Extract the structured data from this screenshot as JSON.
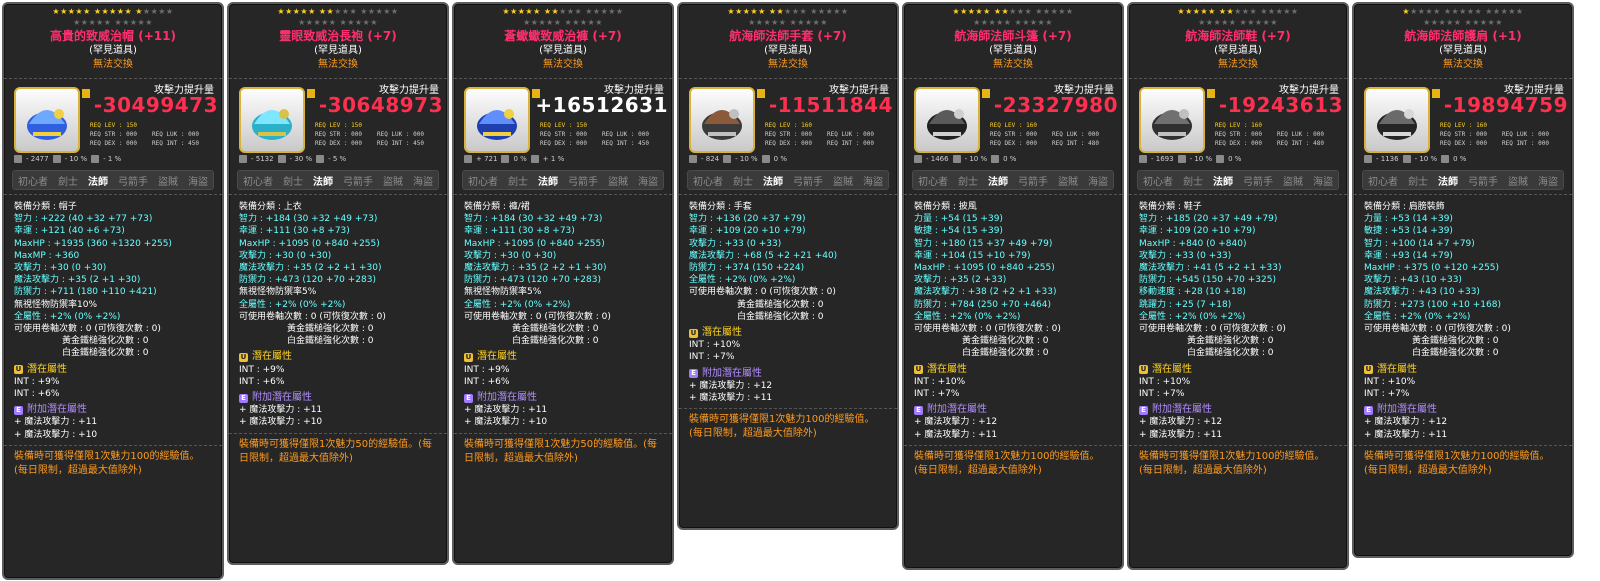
{
  "colors": {
    "name": "#ff2f6e",
    "star": "#ffd21f",
    "atk_negative": "#ff2f4f",
    "panel": "#262626",
    "green": "#58ff58",
    "purple": "#b18cff",
    "orange": "#ff9b1e"
  },
  "labels": {
    "rank": "(罕見道具)",
    "tradeable": "無法交換",
    "atk_gain": "攻擊力提升量",
    "jobs": [
      "初心者",
      "劍士",
      "法師",
      "弓箭手",
      "盜賊",
      "海盜"
    ],
    "potential": "潛在屬性",
    "additional_potential": "附加潛在屬性"
  },
  "items": [
    {
      "name": "高貴的致威治帽 (+11)",
      "stars_filled": 11,
      "atk_change": "-30499473",
      "req_lev": "REQ LEV : 150",
      "req": [
        "REQ STR : 000",
        "REQ LUK : 000",
        "REQ DEX : 000",
        "REQ INT : 450"
      ],
      "mini": [
        "- 2477",
        "- 10 %",
        "- 1 %"
      ],
      "stats": [
        "裝備分類 : 帽子",
        "智力 : +222 (40 +32 +77 +73)",
        "幸運 : +121 (40 +6 +73)",
        "MaxHP : +1935 (360 +1320 +255)",
        "MaxMP : +360",
        "攻擊力 : +30 (0 +30)",
        "魔法攻擊力 : +35 (2 +1 +30)",
        "防禦力 : +711 (180 +110 +421)",
        "無視怪物防禦率10%",
        "全屬性 : +2% (0% +2%)",
        "可使用卷軸次數 : 0 (可恢復次數 : 0)",
        "黃金鐵槌強化次數 : 0",
        "白金鐵槌強化次數 : 0"
      ],
      "potential": [
        "INT : +9%",
        "INT : +6%"
      ],
      "additional": [
        "+ 魔法攻擊力 : +11",
        "+ 魔法攻擊力 : +10"
      ],
      "footer": "裝備時可獲得僅限1次魅力100的經驗值。(每日限制，超過最大值除外)"
    },
    {
      "name": "靈眼致威治長袍 (+7)",
      "stars_filled": 7,
      "atk_change": "-30648973",
      "req_lev": "REQ LEV : 150",
      "req": [
        "REQ STR : 000",
        "REQ LUK : 000",
        "REQ DEX : 000",
        "REQ INT : 450"
      ],
      "mini": [
        "- 5132",
        "- 30 %",
        "- 5 %"
      ],
      "stats": [
        "裝備分類 : 上衣",
        "智力 : +184 (30 +32 +49 +73)",
        "幸運 : +111 (30 +8 +73)",
        "MaxHP : +1095 (0 +840 +255)",
        "攻擊力 : +30 (0 +30)",
        "魔法攻擊力 : +35 (2 +2 +1 +30)",
        "防禦力 : +473 (120 +70 +283)",
        "無視怪物防禦率5%",
        "全屬性 : +2% (0% +2%)",
        "可使用卷軸次數 : 0 (可恢復次數 : 0)",
        "黃金鐵槌強化次數 : 0",
        "白金鐵槌強化次數 : 0"
      ],
      "potential": [
        "INT : +9%",
        "INT : +6%"
      ],
      "additional": [
        "+ 魔法攻擊力 : +11",
        "+ 魔法攻擊力 : +10"
      ],
      "footer": "裝備時可獲得僅限1次魅力50的經驗值。(每日限制，超過最大值除外)"
    },
    {
      "name": "蒼蠍蠍致威治褲 (+7)",
      "stars_filled": 7,
      "atk_change": "+16512631",
      "req_lev": "REQ LEV : 150",
      "req": [
        "REQ STR : 000",
        "REQ LUK : 000",
        "REQ DEX : 000",
        "REQ INT : 450"
      ],
      "mini": [
        "+ 721",
        "0 %",
        "+ 1 %"
      ],
      "stats": [
        "裝備分類 : 褲/裙",
        "智力 : +184 (30 +32 +49 +73)",
        "幸運 : +111 (30 +8 +73)",
        "MaxHP : +1095 (0 +840 +255)",
        "攻擊力 : +30 (0 +30)",
        "魔法攻擊力 : +35 (2 +2 +1 +30)",
        "防禦力 : +473 (120 +70 +283)",
        "無視怪物防禦率5%",
        "全屬性 : +2% (0% +2%)",
        "可使用卷軸次數 : 0 (可恢復次數 : 0)",
        "黃金鐵槌強化次數 : 0",
        "白金鐵槌強化次數 : 0"
      ],
      "potential": [
        "INT : +9%",
        "INT : +6%"
      ],
      "additional": [
        "+ 魔法攻擊力 : +11",
        "+ 魔法攻擊力 : +10"
      ],
      "footer": "裝備時可獲得僅限1次魅力50的經驗值。(每日限制，超過最大值除外)"
    },
    {
      "name": "航海師法師手套 (+7)",
      "stars_filled": 7,
      "atk_change": "-11511844",
      "req_lev": "REQ LEV : 160",
      "req": [
        "REQ STR : 000",
        "REQ LUK : 000",
        "REQ DEX : 000",
        "REQ INT : 000"
      ],
      "mini": [
        "- 824",
        "- 10 %",
        "0 %"
      ],
      "stats": [
        "裝備分類 : 手套",
        "智力 : +136 (20 +37 +79)",
        "幸運 : +109 (20 +10 +79)",
        "攻擊力 : +33 (0 +33)",
        "魔法攻擊力 : +68 (5 +2 +21 +40)",
        "防禦力 : +374 (150 +224)",
        "全屬性 : +2% (0% +2%)",
        "可使用卷軸次數 : 0 (可恢復次數 : 0)",
        "黃金鐵槌強化次數 : 0",
        "白金鐵槌強化次數 : 0"
      ],
      "potential": [
        "INT : +10%",
        "INT : +7%"
      ],
      "additional": [
        "+ 魔法攻擊力 : +12",
        "+ 魔法攻擊力 : +11"
      ],
      "footer": "裝備時可獲得僅限1次魅力100的經驗值。(每日限制，超過最大值除外)"
    },
    {
      "name": "航海師法師斗篷 (+7)",
      "stars_filled": 7,
      "atk_change": "-23327980",
      "req_lev": "REQ LEV : 160",
      "req": [
        "REQ STR : 000",
        "REQ LUK : 000",
        "REQ DEX : 000",
        "REQ INT : 480"
      ],
      "mini": [
        "- 1466",
        "- 10 %",
        "0 %"
      ],
      "stats": [
        "裝備分類 : 披風",
        "力量 : +54 (15 +39)",
        "敏捷 : +54 (15 +39)",
        "智力 : +180 (15 +37 +49 +79)",
        "幸運 : +104 (15 +10 +79)",
        "MaxHP : +1095 (0 +840 +255)",
        "攻擊力 : +35 (2 +33)",
        "魔法攻擊力 : +38 (2 +2 +1 +33)",
        "防禦力 : +784 (250 +70 +464)",
        "全屬性 : +2% (0% +2%)",
        "可使用卷軸次數 : 0 (可恢復次數 : 0)",
        "黃金鐵槌強化次數 : 0",
        "白金鐵槌強化次數 : 0"
      ],
      "potential": [
        "INT : +10%",
        "INT : +7%"
      ],
      "additional": [
        "+ 魔法攻擊力 : +12",
        "+ 魔法攻擊力 : +11"
      ],
      "footer": "裝備時可獲得僅限1次魅力100的經驗值。(每日限制，超過最大值除外)"
    },
    {
      "name": "航海師法師鞋 (+7)",
      "stars_filled": 7,
      "atk_change": "-19243613",
      "req_lev": "REQ LEV : 160",
      "req": [
        "REQ STR : 000",
        "REQ LUK : 000",
        "REQ DEX : 000",
        "REQ INT : 480"
      ],
      "mini": [
        "- 1693",
        "- 10 %",
        "0 %"
      ],
      "stats": [
        "裝備分類 : 鞋子",
        "智力 : +185 (20 +37 +49 +79)",
        "幸運 : +109 (20 +10 +79)",
        "MaxHP : +840 (0 +840)",
        "攻擊力 : +33 (0 +33)",
        "魔法攻擊力 : +41 (5 +2 +1 +33)",
        "防禦力 : +545 (150 +70 +325)",
        "移動速度 : +28 (10 +18)",
        "跳躍力 : +25 (7 +18)",
        "全屬性 : +2% (0% +2%)",
        "可使用卷軸次數 : 0 (可恢復次數 : 0)",
        "黃金鐵槌強化次數 : 0",
        "白金鐵槌強化次數 : 0"
      ],
      "potential": [
        "INT : +10%",
        "INT : +7%"
      ],
      "additional": [
        "+ 魔法攻擊力 : +12",
        "+ 魔法攻擊力 : +11"
      ],
      "footer": "裝備時可獲得僅限1次魅力100的經驗值。(每日限制，超過最大值除外)"
    },
    {
      "name": "航海師法師護肩 (+1)",
      "stars_filled": 1,
      "atk_change": "-19894759",
      "req_lev": "REQ LEV : 160",
      "req": [
        "REQ STR : 000",
        "REQ LUK : 000",
        "REQ DEX : 000",
        "REQ INT : 000"
      ],
      "mini": [
        "- 1136",
        "- 10 %",
        "0 %"
      ],
      "stats": [
        "裝備分類 : 肩膀裝飾",
        "力量 : +53 (14 +39)",
        "敏捷 : +53 (14 +39)",
        "智力 : +100 (14 +7 +79)",
        "幸運 : +93 (14 +79)",
        "MaxHP : +375 (0 +120 +255)",
        "攻擊力 : +43 (10 +33)",
        "魔法攻擊力 : +43 (10 +33)",
        "防禦力 : +273 (100 +10 +168)",
        "全屬性 : +2% (0% +2%)",
        "可使用卷軸次數 : 0 (可恢復次數 : 0)",
        "黃金鐵槌強化次數 : 0",
        "白金鐵槌強化次數 : 0"
      ],
      "potential": [
        "INT : +10%",
        "INT : +7%"
      ],
      "additional": [
        "+ 魔法攻擊力 : +12",
        "+ 魔法攻擊力 : +11"
      ],
      "footer": "裝備時可獲得僅限1次魅力100的經驗值。(每日限制，超過最大值除外)"
    }
  ]
}
